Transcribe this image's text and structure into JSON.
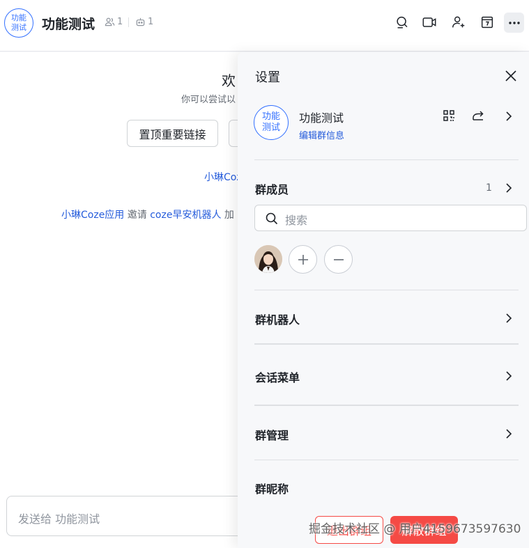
{
  "header": {
    "avatar_line1": "功能",
    "avatar_line2": "测试",
    "title": "功能测试",
    "member_count": "1",
    "bot_count": "1"
  },
  "chat": {
    "welcome": "欢",
    "welcome_sub": "你可以尝试以",
    "pin_button": "置顶重要链接",
    "system_line1": "小琳Coz",
    "system_line2": {
      "inviter": "小琳Coze应用",
      "invite_word": "邀请",
      "invitee": "coze早安机器人",
      "tail": "加"
    },
    "compose_placeholder": "发送给 功能测试"
  },
  "settings": {
    "title": "设置",
    "group_avatar_line1": "功能",
    "group_avatar_line2": "测试",
    "group_name": "功能测试",
    "edit_link": "编辑群信息",
    "members_label": "群成员",
    "members_count": "1",
    "search_placeholder": "搜索",
    "bots_label": "群机器人",
    "menu_label": "会话菜单",
    "manage_label": "群管理",
    "nickname_label": "群昵称",
    "exit_button": "退出群组",
    "dismiss_button": "解散群组"
  },
  "watermark": "掘金技术社区 @ 用户4159673597630",
  "colors": {
    "accent": "#3370ff",
    "link": "#245bdb",
    "danger": "#f54a45"
  }
}
